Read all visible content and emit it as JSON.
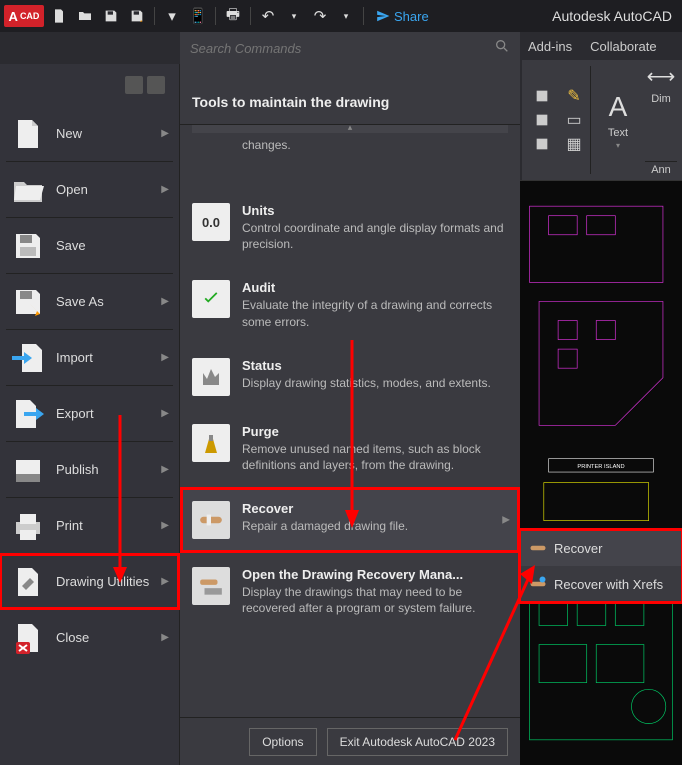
{
  "app": {
    "title": "Autodesk AutoCAD",
    "logo_text": "CAD"
  },
  "topbar": {
    "share": "Share"
  },
  "search": {
    "placeholder": "Search Commands"
  },
  "ribbon_tabs": {
    "t1": "Add-ins",
    "t2": "Collaborate"
  },
  "ribbon": {
    "text_label": "Text",
    "dim_label": "Dim",
    "anno_label": "Ann"
  },
  "left_menu": {
    "new": "New",
    "open": "Open",
    "save": "Save",
    "save_as": "Save As",
    "import": "Import",
    "export": "Export",
    "publish": "Publish",
    "print": "Print",
    "drawing_utilities": "Drawing Utilities",
    "close": "Close"
  },
  "middle": {
    "title": "Tools to maintain the drawing",
    "changes": "changes.",
    "units": {
      "t": "Units",
      "d": "Control coordinate and angle display formats and precision."
    },
    "audit": {
      "t": "Audit",
      "d": "Evaluate the integrity of a drawing and corrects some errors."
    },
    "status": {
      "t": "Status",
      "d": "Display drawing statistics, modes, and extents."
    },
    "purge": {
      "t": "Purge",
      "d": "Remove unused named items, such as block definitions and layers, from the drawing."
    },
    "recover": {
      "t": "Recover",
      "d": "Repair a damaged drawing file."
    },
    "open_recovery": {
      "t": "Open the Drawing Recovery Mana...",
      "d": "Display the drawings that may need to be recovered after a program or system failure."
    },
    "options_btn": "Options",
    "exit_btn": "Exit Autodesk AutoCAD 2023"
  },
  "submenu": {
    "recover": "Recover",
    "recover_xrefs": "Recover with Xrefs"
  }
}
